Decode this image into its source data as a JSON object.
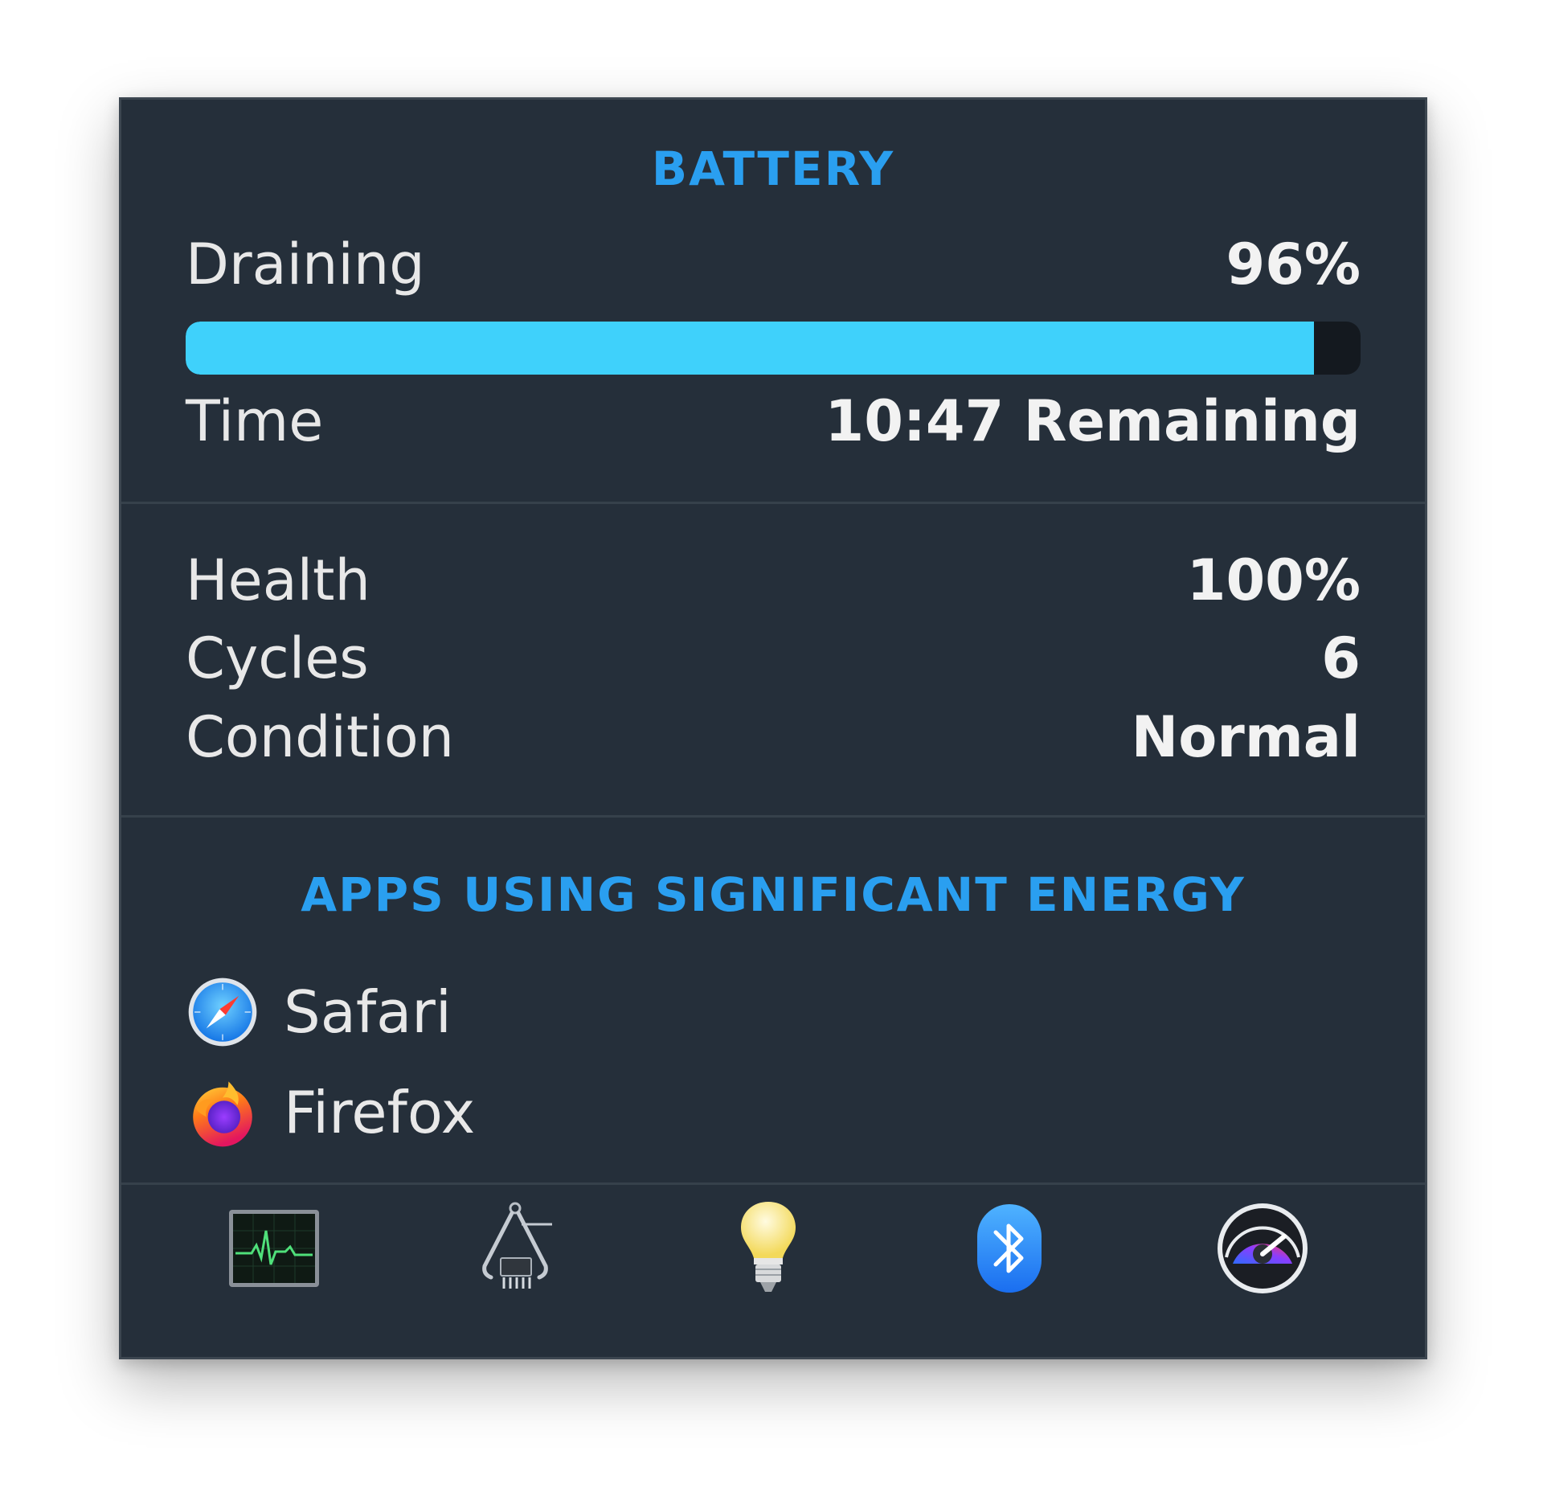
{
  "battery": {
    "heading": "BATTERY",
    "state_label": "Draining",
    "percent_text": "96%",
    "charge_fraction": 0.96,
    "time_label": "Time",
    "time_value": "10:47 Remaining"
  },
  "stats": {
    "health_label": "Health",
    "health_value": "100%",
    "cycles_label": "Cycles",
    "cycles_value": "6",
    "condition_label": "Condition",
    "condition_value": "Normal"
  },
  "apps": {
    "heading": "APPS USING SIGNIFICANT ENERGY",
    "items": [
      {
        "name": "Safari",
        "icon": "safari-icon"
      },
      {
        "name": "Firefox",
        "icon": "firefox-icon"
      }
    ]
  },
  "toolbar": {
    "items": [
      {
        "icon": "activity-monitor-icon"
      },
      {
        "icon": "system-information-icon"
      },
      {
        "icon": "light-bulb-icon"
      },
      {
        "icon": "bluetooth-icon"
      },
      {
        "icon": "istat-gauge-icon"
      }
    ]
  },
  "colors": {
    "panel_bg": "#252f3a",
    "accent": "#2a9ff0",
    "bar_fill": "#3fd1fb",
    "bar_track": "#14191f"
  }
}
